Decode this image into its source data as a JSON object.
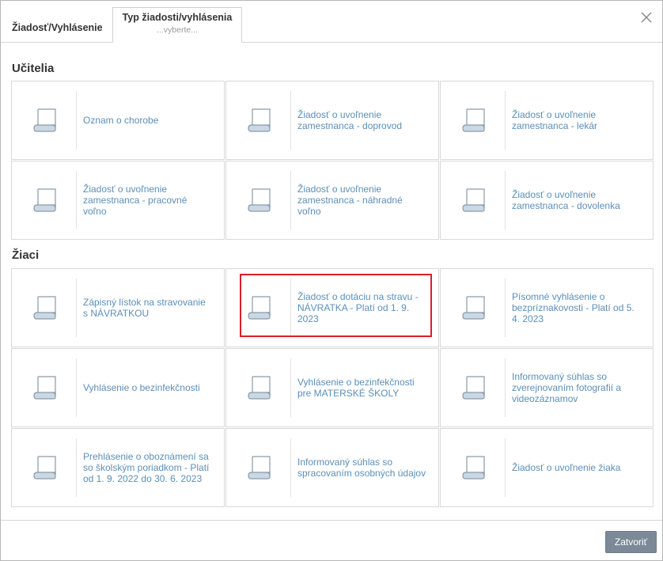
{
  "tabs": [
    {
      "label": "Žiadosť/Vyhlásenie"
    },
    {
      "label": "Typ žiadosti/vyhlásenia",
      "sublabel": "...vyberte..."
    }
  ],
  "sections": [
    {
      "title": "Učitelia",
      "items": [
        {
          "label": "Oznam o chorobe"
        },
        {
          "label": "Žiadosť o uvoľnenie zamestnanca - doprovod"
        },
        {
          "label": "Žiadosť o uvoľnenie zamestnanca - lekár"
        },
        {
          "label": "Žiadosť o uvoľnenie zamestnanca - pracovné voľno"
        },
        {
          "label": "Žiadosť o uvoľnenie zamestnanca - náhradné voľno"
        },
        {
          "label": "Žiadosť o uvoľnenie zamestnanca - dovolenka"
        }
      ]
    },
    {
      "title": "Žiaci",
      "items": [
        {
          "label": "Zápisný lístok na stravovanie s NÁVRATKOU"
        },
        {
          "label": "Žiadosť o dotáciu na stravu - NÁVRATKA - Platí od 1. 9. 2023"
        },
        {
          "label": "Písomné vyhlásenie o bezpríznakovosti - Platí od 5. 4. 2023"
        },
        {
          "label": "Vyhlásenie o bezinfekčnosti"
        },
        {
          "label": "Vyhlásenie o bezinfekčnosti pre MATERSKÉ ŠKOLY"
        },
        {
          "label": "Informovaný súhlas so zverejnovaním fotografií a videozáznamov"
        },
        {
          "label": "Prehlásenie o oboznámení sa so školským poriadkom - Platí od 1. 9. 2022 do 30. 6. 2023"
        },
        {
          "label": "Informovaný súhlas so spracovaním osobných údajov"
        },
        {
          "label": "Žiadosť o uvoľnenie žiaka"
        }
      ]
    }
  ],
  "footer": {
    "close_label": "Zatvoriť"
  },
  "colors": {
    "link": "#5b8fb9",
    "highlight": "#d8202a",
    "button": "#7b8a96"
  },
  "icons": {
    "close": "close-icon",
    "document": "document-scroll-icon"
  }
}
